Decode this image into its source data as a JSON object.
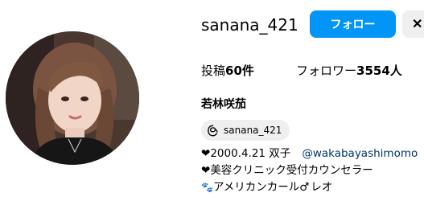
{
  "profile": {
    "username": "sanana_421",
    "follow_label": "フォロー",
    "more_label": "✕",
    "display_name": "若林咲茄",
    "avatar_icon": "profile-photo"
  },
  "stats": {
    "posts_label": "投稿",
    "posts_count": "60件",
    "followers_label": "フォロワー",
    "followers_count": "3554人"
  },
  "threads": {
    "icon": "threads-icon",
    "handle": "sanana_421"
  },
  "bio": {
    "line1_heart": "❤",
    "line1_text": "2000.4.21 双子",
    "line1_mention": "@wakabayashimomo",
    "line2_heart": "❤",
    "line2_text": "美容クリニック受付カウンセラー",
    "line3_paw": "🐾",
    "line3_text": "アメリカンカール",
    "line3_sym": "♂",
    "line3_name": "レオ"
  },
  "colors": {
    "primary_button": "#0095f6",
    "secondary_button": "#efefef",
    "link": "#00376b"
  }
}
